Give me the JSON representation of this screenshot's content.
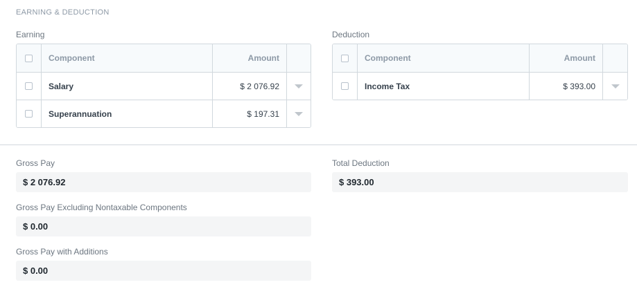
{
  "section_title": "EARNING & DEDUCTION",
  "earning": {
    "label": "Earning",
    "headers": {
      "component": "Component",
      "amount": "Amount"
    },
    "rows": [
      {
        "component": "Salary",
        "amount": "$ 2 076.92"
      },
      {
        "component": "Superannuation",
        "amount": "$ 197.31"
      }
    ]
  },
  "deduction": {
    "label": "Deduction",
    "headers": {
      "component": "Component",
      "amount": "Amount"
    },
    "rows": [
      {
        "component": "Income Tax",
        "amount": "$ 393.00"
      }
    ]
  },
  "totals": {
    "gross_pay": {
      "label": "Gross Pay",
      "value": "$ 2 076.92"
    },
    "gross_pay_excl": {
      "label": "Gross Pay Excluding Nontaxable Components",
      "value": "$ 0.00"
    },
    "gross_pay_add": {
      "label": "Gross Pay with Additions",
      "value": "$ 0.00"
    },
    "total_deduction": {
      "label": "Total Deduction",
      "value": "$ 393.00"
    }
  },
  "icons": {
    "row_action": "caret-down-icon"
  }
}
